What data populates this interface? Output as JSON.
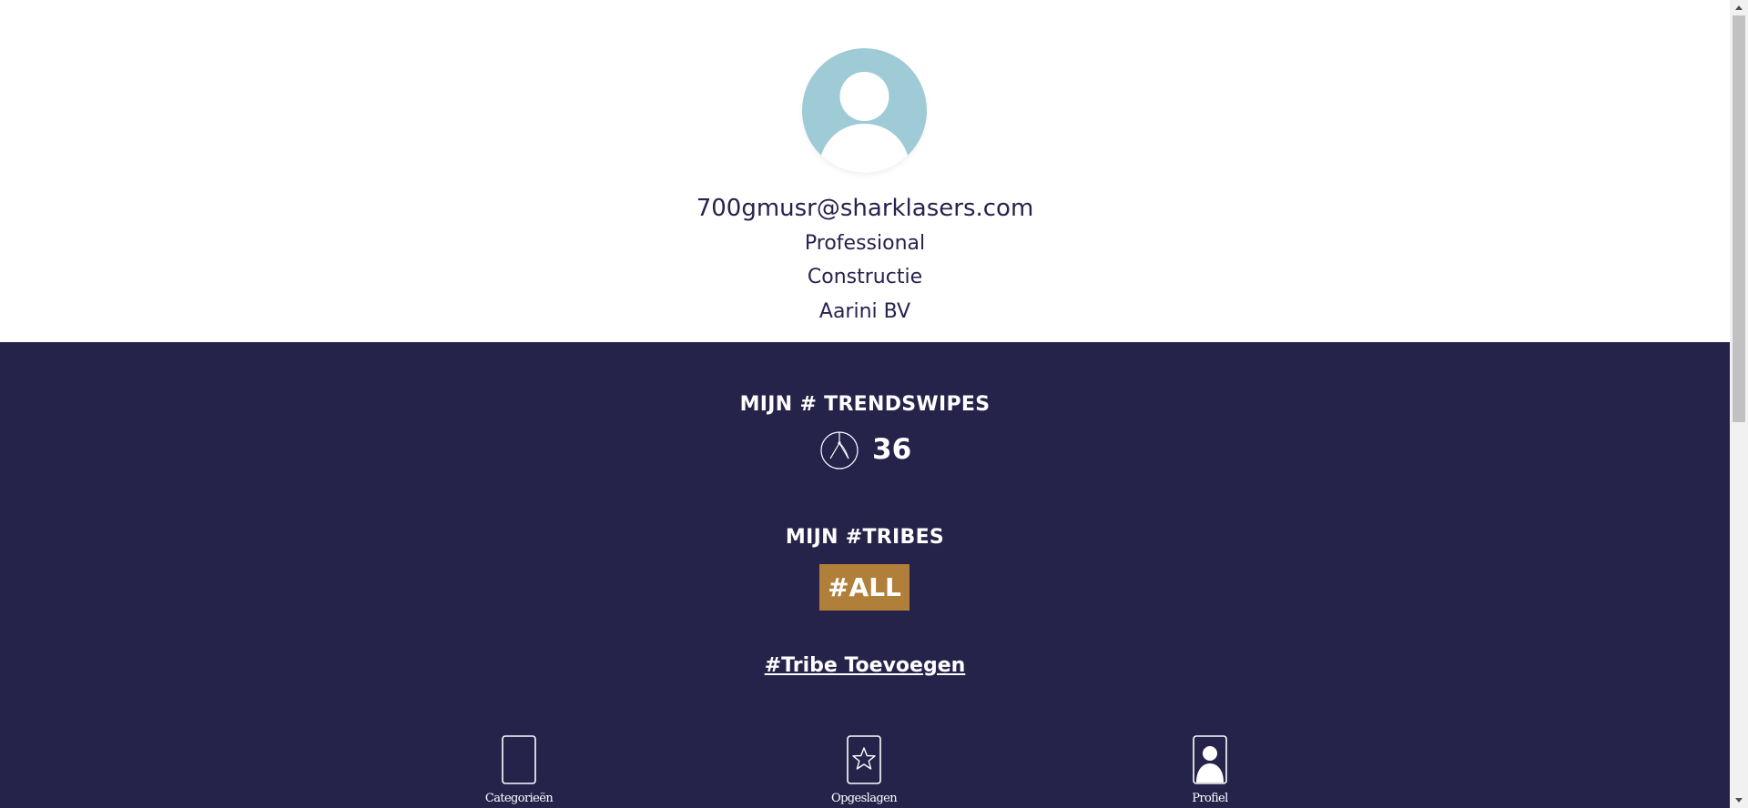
{
  "profile": {
    "email": "700gmusr@sharklasers.com",
    "role": "Professional",
    "sector": "Constructie",
    "company": "Aarini BV",
    "avatar_icon": "user-avatar-icon"
  },
  "trendswipes": {
    "title": "MIJN # TRENDSWIPES",
    "count": "36",
    "icon": "swipe-icon"
  },
  "tribes": {
    "title": "MIJN #TRIBES",
    "tags": [
      "#ALL"
    ],
    "add_link": "#Tribe Toevoegen"
  },
  "bottom_nav": {
    "items": [
      {
        "label": "Categorieën",
        "icon": "card-icon"
      },
      {
        "label": "Opgeslagen",
        "icon": "star-card-icon"
      },
      {
        "label": "Profiel",
        "icon": "profile-card-icon"
      }
    ]
  },
  "colors": {
    "navy": "#26234b",
    "avatar_bg": "#9ecbd5",
    "tag_gold": "#b07f3a",
    "text_dark": "#26234d"
  }
}
